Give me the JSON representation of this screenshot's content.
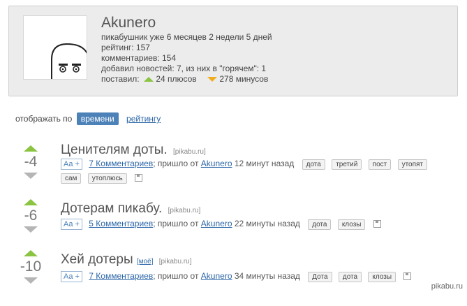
{
  "profile": {
    "username": "Akunero",
    "lines": [
      "пикабушник уже 6 месяцев 2 недели 5 дней",
      "рейтинг: 157",
      "комментариев: 154",
      "добавил новостей: 7, из них в \"горячем\": 1"
    ],
    "voted_label": "поставил:",
    "plus_text": "24 плюсов",
    "minus_text": "278 минусов"
  },
  "sort": {
    "label": "отображать по",
    "active": "времени",
    "other": "рейтингу"
  },
  "stories": [
    {
      "score": "-4",
      "title": "Ценителям доты.",
      "source": "[pikabu.ru]",
      "mine": "",
      "font_btn": "Aa +",
      "comments": "7 Комментариев",
      "posted": "; пришло от",
      "author": "Akunero",
      "time": "12 минут назад",
      "tags": [
        "дота",
        "третий",
        "пост",
        "утопят"
      ],
      "tags2": [
        "сам",
        "утоплюсь"
      ]
    },
    {
      "score": "-6",
      "title": "Дотерам пикабу.",
      "source": "[pikabu.ru]",
      "mine": "",
      "font_btn": "Aa +",
      "comments": "5 Комментариев",
      "posted": "; пришло от",
      "author": "Akunero",
      "time": "22 минуты назад",
      "tags": [
        "дота",
        "клозы"
      ],
      "tags2": []
    },
    {
      "score": "-10",
      "title": "Хей дотеры",
      "source": "[pikabu.ru]",
      "mine": "[моё]",
      "font_btn": "Aa +",
      "comments": "7 Комментариев",
      "posted": "; пришло от",
      "author": "Akunero",
      "time": "34 минуты назад",
      "tags": [
        "Дота",
        "дота",
        "клозы"
      ],
      "tags2": []
    }
  ],
  "watermark": "pikabu.ru",
  "colors": {
    "up": "#8ac440",
    "down": "#f0ad1d",
    "link": "#2c66a8",
    "active_sort": "#4d82b8"
  }
}
